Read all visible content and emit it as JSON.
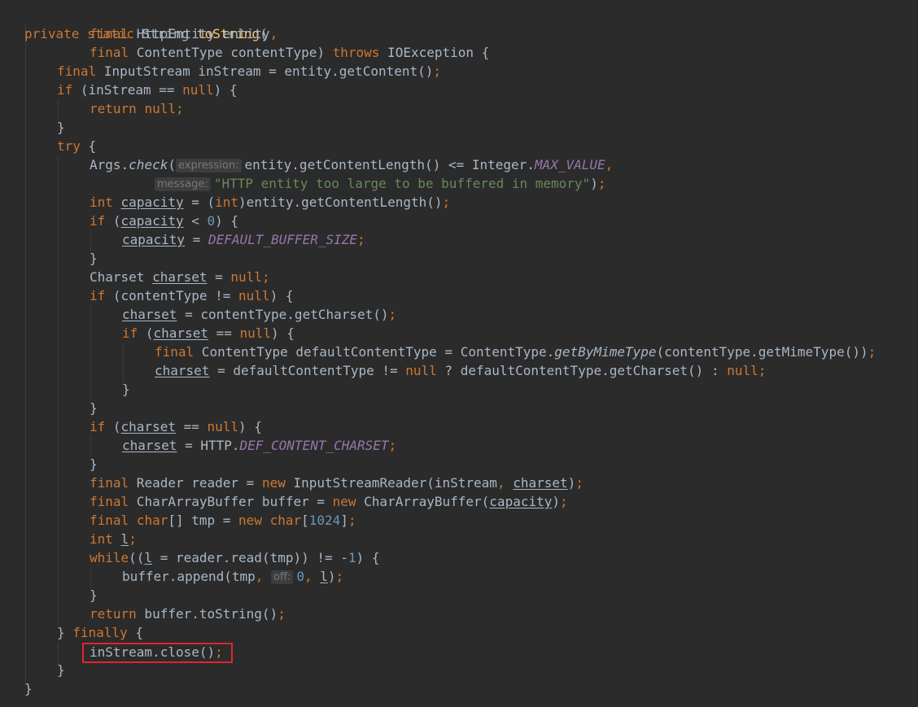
{
  "editor": {
    "method": {
      "modifiers": "private static",
      "return_type": "String",
      "name": "toString",
      "open": "("
    },
    "params": {
      "p1_final": "final",
      "p1_text": " HttpEntity entity",
      "p1_comma": ",",
      "p2_final": "final",
      "p2_text": " ContentType contentType) ",
      "throws": "throws",
      "throws_rest": " IOException {"
    },
    "body": {
      "l4_final": "final",
      "l4_text": " InputStream inStream = entity.getContent()",
      "semi": ";",
      "if": "if",
      "l5_a": " (inStream == ",
      "null": "null",
      "l5_b": ") {",
      "return": "return",
      "brace_close": "}",
      "try": "try",
      "l9_b": " {",
      "args": "Args.",
      "check": "check",
      "paren": "(",
      "hint_expression": "expression:",
      "l10_rest": "entity.getContentLength() <= Integer.",
      "max_value": "MAX_VALUE",
      "comma": ",",
      "hint_message": "message:",
      "message_str": "\"HTTP entity too large to be buffered in memory\"",
      "l11_close": ")",
      "int": "int",
      "capacity": "capacity",
      "l12_eq": " = (",
      "l12_rest": ")entity.getContentLength()",
      "l13_lt": " < ",
      "zero": "0",
      "l13_close": ") {",
      "l14_eq": " = ",
      "default_buffer_size": "DEFAULT_BUFFER_SIZE",
      "charset_type": "Charset ",
      "charset": "charset",
      "l16_eq": " = ",
      "l17_a": " (contentType != ",
      "l18_rest": " = contentType.getCharset()",
      "l19_a": " (",
      "l19_b": " == ",
      "l20_a": " ContentType defaultContentType = ContentType.",
      "get_by_mime": "getByMimeType",
      "l20_b": "(contentType.getMimeType())",
      "l21_a": " = defaultContentType != ",
      "l21_b": " ? defaultContentType.getCharset() : ",
      "l25_rest": " = HTTP.",
      "def_content_charset": "DEF_CONTENT_CHARSET",
      "l27_a": " Reader reader = ",
      "new": "new",
      "l27_b": " InputStreamReader(inStream",
      "l27_c": ")",
      "l28_a": " CharArrayBuffer buffer = ",
      "l28_b": " CharArrayBuffer(",
      "l29_a": " ",
      "char": "char",
      "l29_b": "[] tmp = ",
      "l29_c": "[",
      "n1024": "1024",
      "l29_d": "]",
      "l_var": "l",
      "while": "while",
      "l31_a": "((",
      "l31_b": " = reader.read(tmp)) != -",
      "one": "1",
      "l31_c": ") {",
      "l32_a": "buffer.append(tmp",
      "hint_off": "off:",
      "l32_c": ")",
      "l34_rest": " buffer.toString()",
      "finally": "finally",
      "l35_a": "} ",
      "l36_text": "inStream.close()",
      "final_brace": "}"
    },
    "highlight_color": "#e0242f"
  }
}
